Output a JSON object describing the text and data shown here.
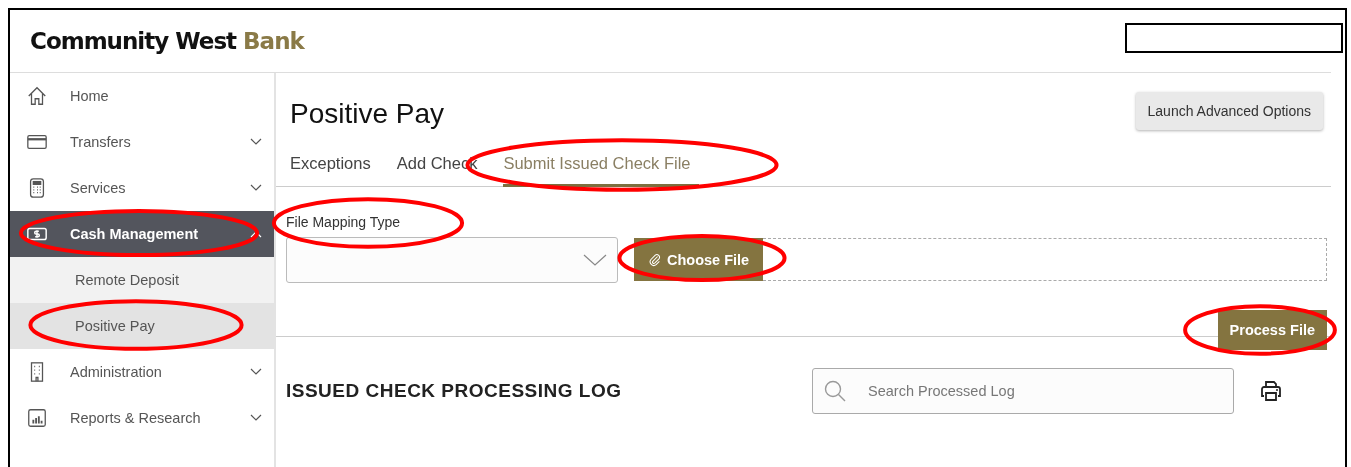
{
  "header": {
    "logo": {
      "brand": "Community West",
      "accent": "Bank"
    },
    "redacted": true
  },
  "sidebar": {
    "items": [
      {
        "label": "Home",
        "kind": "home",
        "selected": false,
        "highlighted": false
      },
      {
        "label": "Transfers",
        "kind": "card",
        "expanded": false,
        "selected": false,
        "highlighted": false
      },
      {
        "label": "Services",
        "kind": "calculator",
        "expanded": false,
        "selected": false,
        "highlighted": false
      },
      {
        "label": "Cash Management",
        "kind": "cash",
        "expanded": true,
        "selected": true,
        "highlighted": true,
        "children": [
          {
            "label": "Remote Deposit",
            "selected": false,
            "highlighted": false
          },
          {
            "label": "Positive Pay",
            "selected": true,
            "highlighted": true
          }
        ]
      },
      {
        "label": "Administration",
        "kind": "building",
        "expanded": false,
        "selected": false,
        "highlighted": false
      },
      {
        "label": "Reports & Research",
        "kind": "chart",
        "expanded": false,
        "selected": false,
        "highlighted": false
      }
    ]
  },
  "page": {
    "title": "Positive Pay",
    "advanced_button": "Launch Advanced Options",
    "tabs": [
      {
        "label": "Exceptions",
        "selected": false,
        "highlighted": false
      },
      {
        "label": "Add Check",
        "selected": false,
        "highlighted": false
      },
      {
        "label": "Submit Issued Check File",
        "selected": true,
        "highlighted": true
      }
    ],
    "form": {
      "field_label": "File Mapping Type",
      "field_label_highlighted": true,
      "choose_button": "Choose File",
      "choose_highlighted": true,
      "process_button": "Process File",
      "process_highlighted": true
    },
    "log": {
      "heading": "ISSUED CHECK PROCESSING LOG",
      "search": {
        "placeholder": "Search Processed Log"
      }
    }
  }
}
